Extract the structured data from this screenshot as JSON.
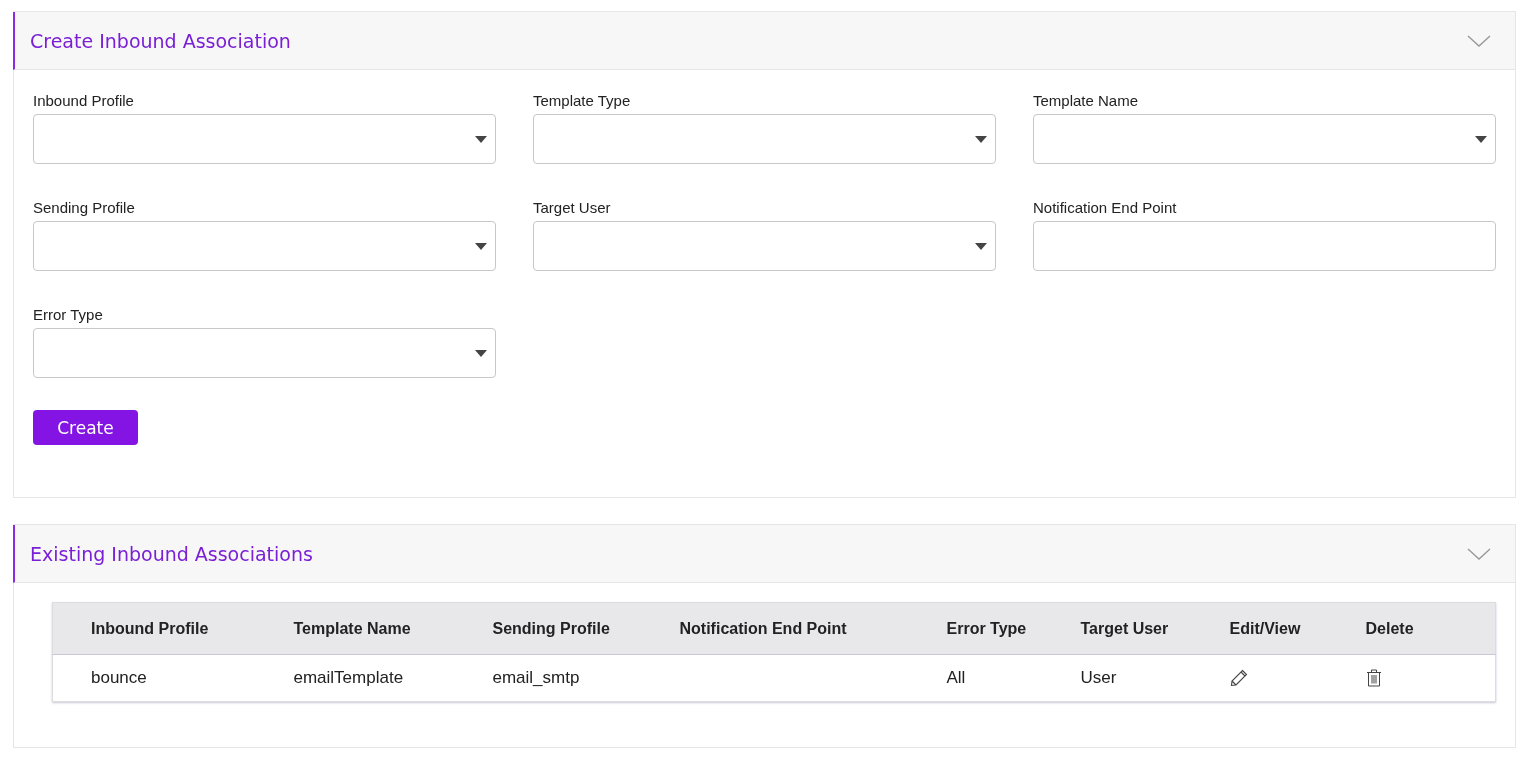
{
  "create_panel": {
    "title": "Create Inbound Association",
    "fields": [
      {
        "label": "Inbound Profile",
        "kind": "select"
      },
      {
        "label": "Template Type",
        "kind": "select"
      },
      {
        "label": "Template Name",
        "kind": "select"
      },
      {
        "label": "Sending Profile",
        "kind": "select"
      },
      {
        "label": "Target User",
        "kind": "select"
      },
      {
        "label": "Notification End Point",
        "kind": "text"
      },
      {
        "label": "Error Type",
        "kind": "select"
      }
    ],
    "button": "Create"
  },
  "existing_panel": {
    "title": "Existing Inbound Associations",
    "table": {
      "columns": [
        "Inbound Profile",
        "Template Name",
        "Sending Profile",
        "Notification End Point",
        "Error Type",
        "Target User",
        "Edit/View",
        "Delete"
      ],
      "rows": [
        {
          "cells": [
            {
              "kind": "text",
              "text": "bounce"
            },
            {
              "kind": "text",
              "text": "emailTemplate"
            },
            {
              "kind": "text",
              "text": "email_smtp"
            },
            {
              "kind": "empty"
            },
            {
              "kind": "text",
              "text": "All"
            },
            {
              "kind": "text",
              "text": "User"
            },
            {
              "kind": "edit"
            },
            {
              "kind": "delete"
            }
          ]
        }
      ]
    }
  }
}
